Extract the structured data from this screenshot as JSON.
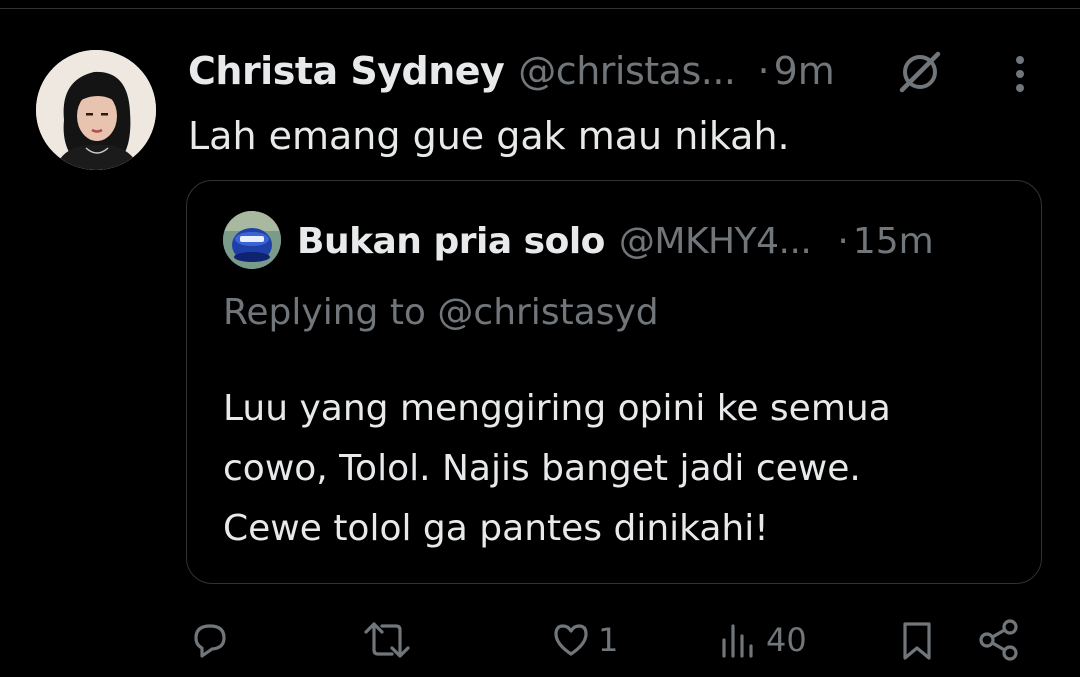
{
  "tweet": {
    "author": {
      "display_name": "Christa Sydney",
      "handle": "@christas...",
      "avatar_icon": "profile-photo"
    },
    "separator": "·",
    "time": "9m",
    "text": "Lah emang gue gak mau nikah.",
    "header_icons": [
      "grok-icon",
      "more-icon"
    ]
  },
  "quoted_tweet": {
    "author": {
      "display_name": "Bukan pria solo",
      "handle": "@MKHY4...",
      "avatar_icon": "blue-can-profile-photo"
    },
    "separator": "·",
    "time": "15m",
    "replying_to": "Replying to @christasyd",
    "text_lines": [
      "Luu yang menggiring opini ke semua",
      "cowo, Tolol. Najis banget jadi cewe.",
      "Cewe tolol ga pantes dinikahi!"
    ]
  },
  "actions": {
    "reply": {
      "icon": "reply-icon",
      "count": ""
    },
    "retweet": {
      "icon": "retweet-icon",
      "count": ""
    },
    "like": {
      "icon": "heart-icon",
      "count": "1"
    },
    "views": {
      "icon": "views-icon",
      "count": "40"
    },
    "bookmark": {
      "icon": "bookmark-icon",
      "count": ""
    },
    "share": {
      "icon": "share-icon",
      "count": ""
    }
  },
  "colors": {
    "background": "#000000",
    "primary_text": "#e7e9ea",
    "secondary_text": "#71767b",
    "border": "#2f3336"
  }
}
